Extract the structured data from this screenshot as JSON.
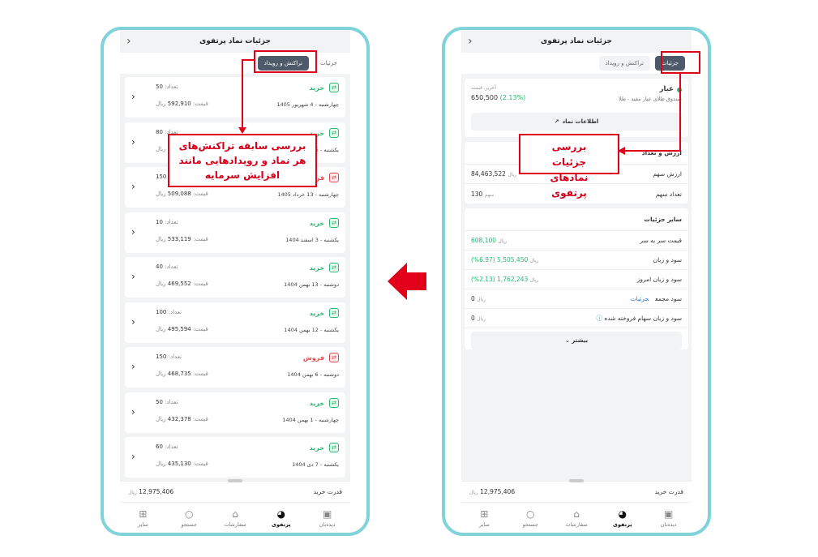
{
  "left_screen": {
    "title": "جزئیات نماد پرتفوی",
    "tabs": [
      "جزئیات",
      "تراکنش و رویداد"
    ],
    "qty_label": "تعداد:",
    "price_label": "قیمت:",
    "currency": "ریال",
    "transactions": [
      {
        "type": "خرید",
        "kind": "buy",
        "date": "چهارشنبه - 4 شهریور 1405",
        "qty": "50",
        "price": "592,910"
      },
      {
        "type": "خرید",
        "kind": "buy",
        "date": "یکشنبه - 1405",
        "qty": "80",
        "price": "6"
      },
      {
        "type": "فروش",
        "kind": "sell",
        "date": "چهارشنبه - 13 خرداد 1405",
        "qty": "150",
        "price": "509,088"
      },
      {
        "type": "خرید",
        "kind": "buy",
        "date": "یکشنبه - 3 اسفند 1404",
        "qty": "10",
        "price": "533,119"
      },
      {
        "type": "خرید",
        "kind": "buy",
        "date": "دوشنبه - 13 بهمن 1404",
        "qty": "40",
        "price": "469,552"
      },
      {
        "type": "خرید",
        "kind": "buy",
        "date": "یکشنبه - 12 بهمن 1404",
        "qty": "100",
        "price": "495,594"
      },
      {
        "type": "فروش",
        "kind": "sell",
        "date": "دوشنبه - 6 بهمن 1404",
        "qty": "150",
        "price": "468,735"
      },
      {
        "type": "خرید",
        "kind": "buy",
        "date": "چهارشنبه - 1 بهمن 1404",
        "qty": "50",
        "price": "432,378"
      },
      {
        "type": "خرید",
        "kind": "buy",
        "date": "یکشنبه - 7 دی 1404",
        "qty": "60",
        "price": "435,130"
      }
    ],
    "buying_power_label": "قدرت خرید",
    "buying_power_value": "12,975,406",
    "callout": "بررسی سابقه تراکنش‌های هر نماد و رویدادهایی مانند افزایش سرمایه"
  },
  "right_screen": {
    "title": "جزئیات نماد پرتفوی",
    "tabs": [
      "جزئیات",
      "تراکنش و رویداد"
    ],
    "asset_name": "عیار",
    "asset_sub": "صندوق طلای عیار مفید - طلا",
    "last_price_label": "آخرین قیمت",
    "last_price": "650,500",
    "last_price_pct": "(2.13%)",
    "info_button": "اطلاعات نماد",
    "value_section_title": "ارزش و تعداد",
    "share_value_label": "ارزش سهم",
    "share_value": "84,463,522",
    "share_count_label": "تعداد سهم",
    "share_count": "130",
    "share_unit": "سهم",
    "other_title": "سایر جزئیات",
    "breakeven_label": "قیمت سر به سر",
    "breakeven": "608,100",
    "pnl_label": "سود و زیان",
    "pnl": "5,505,450 (6.97%)",
    "today_pnl_label": "سود و زیان امروز",
    "today_pnl": "1,762,243 (2.13%)",
    "total_profit_label": "سود مجمع",
    "total_profit_link": "جزئیات",
    "total_profit": "0",
    "sold_pnl_label": "سود و زیان سهام فروخته شده",
    "sold_pnl": "0",
    "more_button": "بیشتر",
    "buying_power_label": "قدرت خرید",
    "buying_power_value": "12,975,406",
    "callout": "بررسی جزئیات نمادهای پرتفوی",
    "currency": "ریال"
  },
  "nav": [
    {
      "label": "دیده‌بان",
      "icon": "watchlist-icon"
    },
    {
      "label": "پرتفوی",
      "icon": "portfolio-icon"
    },
    {
      "label": "سفارشات",
      "icon": "orders-icon"
    },
    {
      "label": "جستجو",
      "icon": "search-icon"
    },
    {
      "label": "سایر",
      "icon": "more-icon"
    }
  ],
  "colors": {
    "accent": "#e3001b",
    "frame": "#7fd3d9",
    "buy": "#2bb673",
    "sell": "#e24b4b",
    "tab_active": "#4e5a6a"
  }
}
